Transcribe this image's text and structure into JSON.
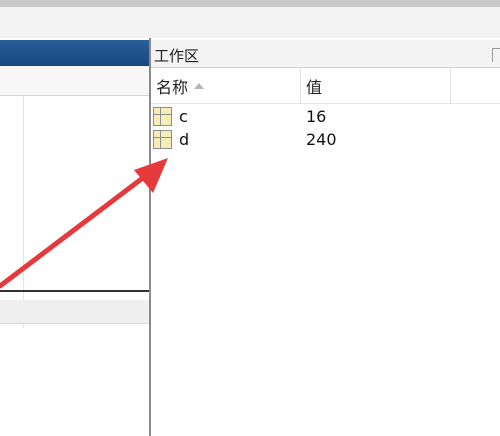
{
  "workspace": {
    "title": "工作区",
    "columns": [
      {
        "label": "名称",
        "sorted": "ascending"
      },
      {
        "label": "值"
      }
    ],
    "variables": [
      {
        "name": "c",
        "value": "16",
        "icon": "matrix-icon"
      },
      {
        "name": "d",
        "value": "240",
        "icon": "matrix-icon"
      }
    ]
  },
  "annotation": {
    "color": "#e5393b"
  }
}
